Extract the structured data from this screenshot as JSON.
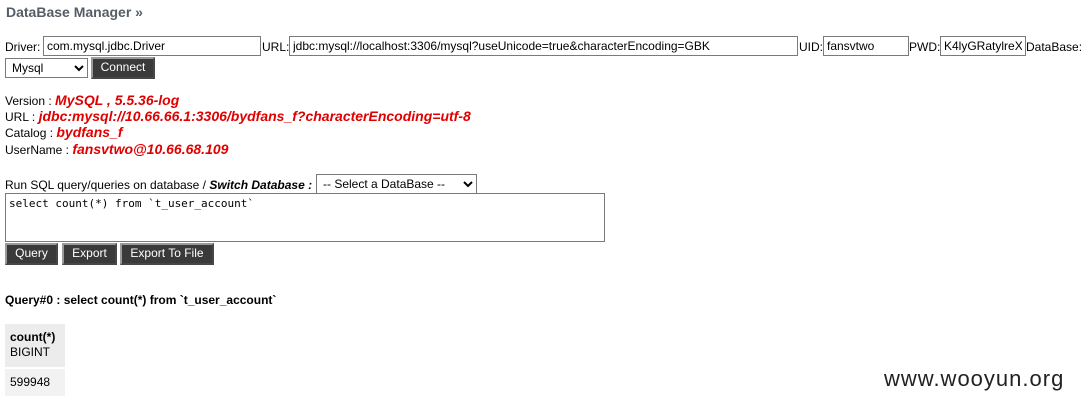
{
  "header": {
    "title": "DataBase Manager »"
  },
  "connection": {
    "driver_label": "Driver:",
    "driver_value": "com.mysql.jdbc.Driver",
    "url_label": "URL:",
    "url_value": "jdbc:mysql://localhost:3306/mysql?useUnicode=true&characterEncoding=GBK",
    "uid_label": "UID:",
    "uid_value": "fansvtwo",
    "pwd_label": "PWD:",
    "pwd_value": "K4lyGRatylreX",
    "database_label": "DataBase:",
    "db_type_selected": "Mysql",
    "connect_label": "Connect"
  },
  "info": {
    "version_label": "Version :",
    "version_value": "MySQL , 5.5.36-log",
    "url_label": "URL :",
    "url_value": "jdbc:mysql://10.66.66.1:3306/bydfans_f?characterEncoding=utf-8",
    "catalog_label": "Catalog :",
    "catalog_value": "bydfans_f",
    "username_label": "UserName :",
    "username_value": "fansvtwo@10.66.68.109"
  },
  "query": {
    "run_label": "Run SQL query/queries on database /",
    "switch_label": "Switch Database :",
    "select_db_selected": "-- Select a DataBase --",
    "sql_text": "select count(*) from `t_user_account`",
    "buttons": {
      "query": "Query",
      "export": "Export",
      "export_file": "Export To File"
    }
  },
  "result": {
    "title": "Query#0 : select count(*) from `t_user_account`",
    "columns": [
      {
        "name": "count(*)",
        "type": "BIGINT"
      }
    ],
    "rows": [
      [
        "599948"
      ]
    ]
  },
  "watermark": "www.wooyun.org"
}
